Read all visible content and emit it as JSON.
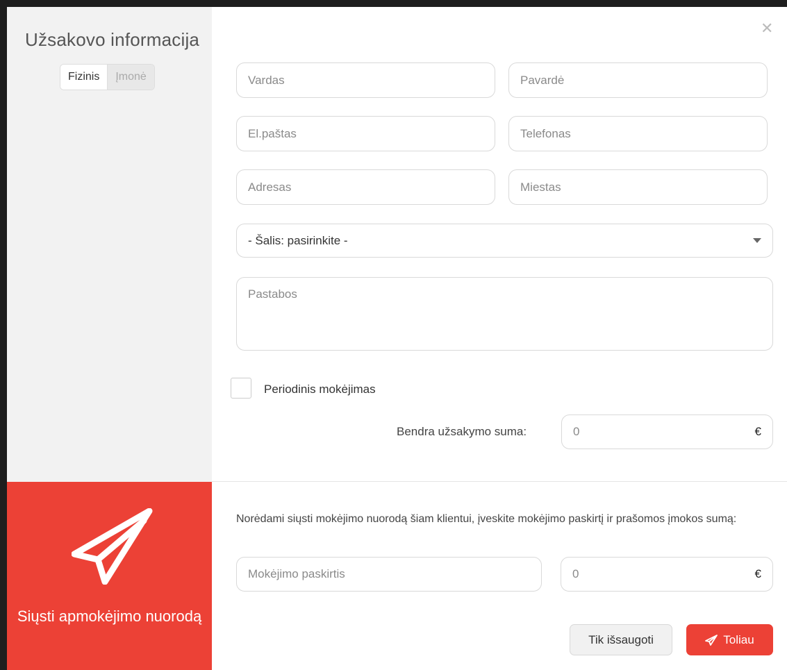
{
  "colors": {
    "accent": "#ec4136",
    "sidebar_bg": "#f2f2f2"
  },
  "sidebar": {
    "title": "Užsakovo informacija",
    "toggle": {
      "individual": "Fizinis",
      "company": "Įmonė",
      "selected": "Fizinis"
    },
    "send_link_label": "Siųsti apmokėjimo nuorodą",
    "send_icon": "paper-plane-icon"
  },
  "close_icon": "close-icon",
  "form": {
    "first_name_placeholder": "Vardas",
    "last_name_placeholder": "Pavardė",
    "email_placeholder": "El.paštas",
    "phone_placeholder": "Telefonas",
    "address_placeholder": "Adresas",
    "city_placeholder": "Miestas",
    "country_select": "- Šalis: pasirinkite -",
    "notes_placeholder": "Pastabos",
    "periodic_payment_label": "Periodinis mokėjimas",
    "periodic_payment_checked": false,
    "total_label": "Bendra užsakymo suma:",
    "total_value": "0",
    "currency": "€"
  },
  "payment_link": {
    "info_text": "Norėdami siųsti mokėjimo nuorodą šiam klientui, įveskite mokėjimo paskirtį ir prašomos įmokos sumą:",
    "purpose_placeholder": "Mokėjimo paskirtis",
    "amount_value": "0",
    "currency": "€"
  },
  "buttons": {
    "save_only": "Tik išsaugoti",
    "next": "Toliau",
    "next_icon": "send-icon"
  }
}
